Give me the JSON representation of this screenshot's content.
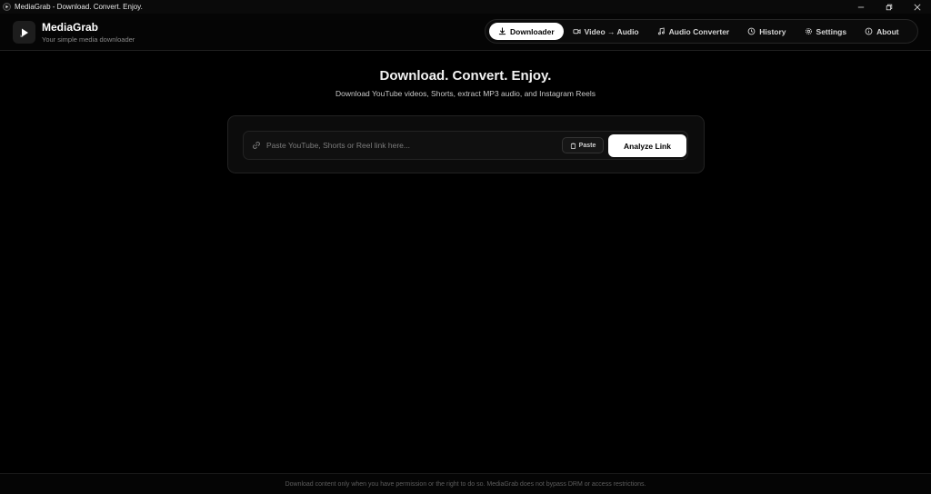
{
  "window": {
    "title": "MediaGrab - Download. Convert. Enjoy."
  },
  "header": {
    "brand_name": "MediaGrab",
    "brand_tagline": "Your simple media downloader"
  },
  "nav": {
    "items": [
      {
        "label": "Downloader",
        "icon": "download-icon",
        "active": true
      },
      {
        "label": "Video → Audio",
        "icon": "video-icon",
        "active": false
      },
      {
        "label": "Audio Converter",
        "icon": "music-note-icon",
        "active": false
      },
      {
        "label": "History",
        "icon": "clock-icon",
        "active": false
      },
      {
        "label": "Settings",
        "icon": "gear-icon",
        "active": false
      },
      {
        "label": "About",
        "icon": "info-icon",
        "active": false
      }
    ]
  },
  "hero": {
    "title": "Download. Convert. Enjoy.",
    "subtitle": "Download YouTube videos, Shorts, extract MP3 audio, and Instagram Reels"
  },
  "url_form": {
    "value": "",
    "placeholder": "Paste YouTube, Shorts or Reel link here...",
    "paste_label": "Paste",
    "analyze_label": "Analyze Link"
  },
  "footer": {
    "disclaimer": "Download content only when you have permission or the right to do so. MediaGrab does not bypass DRM or access restrictions."
  },
  "colors": {
    "background": "#000000",
    "accent": "#ffffff",
    "muted_text": "#8a8a8a"
  }
}
